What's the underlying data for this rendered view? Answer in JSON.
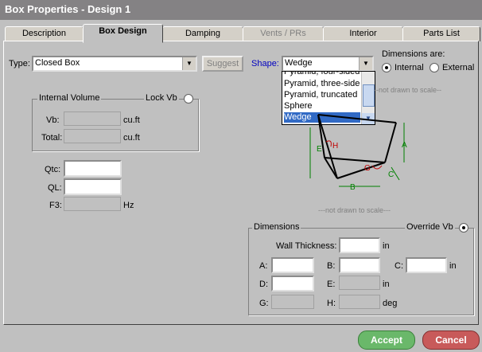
{
  "window": {
    "title": "Box Properties - Design 1"
  },
  "tabs": [
    {
      "label": "Description"
    },
    {
      "label": "Box Design"
    },
    {
      "label": "Damping"
    },
    {
      "label": "Vents / PRs"
    },
    {
      "label": "Interior"
    },
    {
      "label": "Parts List"
    }
  ],
  "type": {
    "label": "Type:",
    "value": "Closed Box",
    "suggest_label": "Suggest"
  },
  "shape": {
    "label": "Shape:",
    "value": "Wedge",
    "options": [
      "Pyramid, four-sided",
      "Pyramid, three-sided",
      "Pyramid, truncated",
      "Sphere",
      "Wedge"
    ],
    "selected": "Wedge"
  },
  "dimensions_are": {
    "label": "Dimensions are:",
    "internal": "Internal",
    "external": "External",
    "selected": "Internal"
  },
  "internal_volume": {
    "caption": "Internal Volume",
    "lock_label": "Lock Vb",
    "vb_label": "Vb:",
    "vb_value": "",
    "vb_unit": "cu.ft",
    "total_label": "Total:",
    "total_value": "",
    "total_unit": "cu.ft"
  },
  "params": {
    "qtc_label": "Qtc:",
    "qtc_value": "",
    "ql_label": "QL:",
    "ql_value": "",
    "f3_label": "F3:",
    "f3_value": "",
    "f3_unit": "Hz"
  },
  "diagram": {
    "labels": {
      "A": "A",
      "B": "B",
      "C": "C",
      "E": "E",
      "G": "G",
      "H": "H"
    },
    "note_top": "--not drawn to scale--",
    "note_bottom": "---not drawn to scale---"
  },
  "dimensions": {
    "caption": "Dimensions",
    "override_label": "Override Vb",
    "wall_label": "Wall Thickness:",
    "wall_unit": "in",
    "a_label": "A:",
    "b_label": "B:",
    "c_label": "C:",
    "c_unit": "in",
    "d_label": "D:",
    "e_label": "E:",
    "e_unit": "in",
    "g_label": "G:",
    "h_label": "H:",
    "h_unit": "deg"
  },
  "actions": {
    "accept": "Accept",
    "cancel": "Cancel"
  },
  "colors": {
    "title_bg": "#848284",
    "accent_green": "#6ab86a",
    "accent_red": "#c85a5a",
    "diagram_green": "#008000",
    "diagram_red": "#c00000",
    "shape_blue": "#0000c0"
  }
}
